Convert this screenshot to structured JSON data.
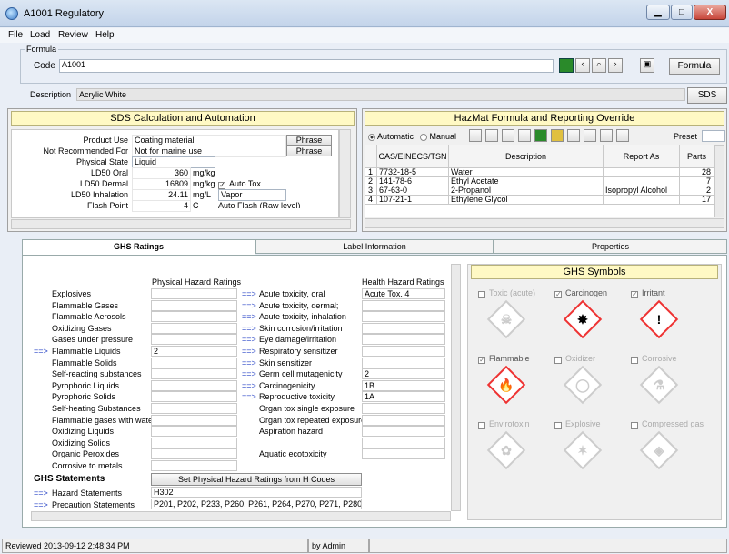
{
  "window": {
    "title": "A1001 Regulatory",
    "minimize": "▁",
    "maximize": "□",
    "close": "X"
  },
  "menu": [
    "File",
    "Load",
    "Review",
    "Help"
  ],
  "formula": {
    "group_label": "Formula",
    "code_label": "Code",
    "code": "A1001",
    "formula_button": "Formula",
    "description_label": "Description",
    "description": "Acrylic White",
    "sds_button": "SDS"
  },
  "sds": {
    "title": "SDS Calculation and Automation",
    "rows": [
      {
        "label": "Product Use",
        "value": "Coating material",
        "button": "Phrase"
      },
      {
        "label": "Not Recommended For",
        "value": "Not for marine use",
        "button": "Phrase"
      },
      {
        "label": "Physical State",
        "value": "Liquid"
      },
      {
        "label": "LD50 Oral",
        "value": "360",
        "unit": "mg/kg"
      },
      {
        "label": "LD50 Dermal",
        "value": "16809",
        "unit": "mg/kg",
        "extra": "Auto Tox"
      },
      {
        "label": "LD50 Inhalation",
        "value": "24.11",
        "unit": "mg/L",
        "extra": "Vapor"
      },
      {
        "label": "Flash Point",
        "value": "4",
        "unit": "C",
        "extra": "Auto Flash (Raw level)"
      }
    ]
  },
  "hazmat": {
    "title": "HazMat Formula and Reporting Override",
    "radio_auto": "Automatic",
    "radio_manual": "Manual",
    "preset_label": "Preset",
    "columns": [
      "CAS/EINECS/TSN",
      "Description",
      "Report As",
      "Parts"
    ],
    "rows": [
      {
        "n": "1",
        "cas": "7732-18-5",
        "desc": "Water",
        "report": "",
        "parts": "28"
      },
      {
        "n": "2",
        "cas": "141-78-6",
        "desc": "Ethyl Acetate",
        "report": "",
        "parts": "7"
      },
      {
        "n": "3",
        "cas": "67-63-0",
        "desc": "2-Propanol",
        "report": "Isopropyl Alcohol",
        "parts": "2"
      },
      {
        "n": "4",
        "cas": "107-21-1",
        "desc": "Ethylene Glycol",
        "report": "",
        "parts": "17"
      }
    ]
  },
  "tabs": [
    "GHS Ratings",
    "Label Information",
    "Properties"
  ],
  "ghs": {
    "phys_header": "Physical Hazard Ratings",
    "health_header": "Health Hazard Ratings",
    "phys": [
      {
        "label": "Explosives",
        "value": ""
      },
      {
        "label": "Flammable Gases",
        "value": ""
      },
      {
        "label": "Flammable Aerosols",
        "value": ""
      },
      {
        "label": "Oxidizing Gases",
        "value": ""
      },
      {
        "label": "Gases under pressure",
        "value": ""
      },
      {
        "label": "Flammable Liquids",
        "value": "2",
        "arrow": "==>"
      },
      {
        "label": "Flammable Solids",
        "value": ""
      },
      {
        "label": "Self-reacting substances",
        "value": ""
      },
      {
        "label": "Pyrophoric Liquids",
        "value": ""
      },
      {
        "label": "Pyrophoric Solids",
        "value": ""
      },
      {
        "label": "Self-heating Substances",
        "value": ""
      },
      {
        "label": "Flammable gases with water",
        "value": ""
      },
      {
        "label": "Oxidizing Liquids",
        "value": ""
      },
      {
        "label": "Oxidizing Solids",
        "value": ""
      },
      {
        "label": "Organic Peroxides",
        "value": ""
      },
      {
        "label": "Corrosive to metals",
        "value": ""
      }
    ],
    "health": [
      {
        "label": "Acute toxicity, oral",
        "value": "Acute Tox. 4",
        "arrow": "==>"
      },
      {
        "label": "Acute toxicity, dermal;",
        "value": "",
        "arrow": "==>"
      },
      {
        "label": "Acute toxicity, inhalation",
        "value": "",
        "arrow": "==>"
      },
      {
        "label": "Skin corrosion/irritation",
        "value": "",
        "arrow": "==>"
      },
      {
        "label": "Eye damage/irritation",
        "value": "",
        "arrow": "==>"
      },
      {
        "label": "Respiratory sensitizer",
        "value": "",
        "arrow": "==>"
      },
      {
        "label": "Skin sensitizer",
        "value": "",
        "arrow": "==>"
      },
      {
        "label": "Germ cell mutagenicity",
        "value": "2",
        "arrow": "==>"
      },
      {
        "label": "Carcinogenicity",
        "value": "1B",
        "arrow": "==>"
      },
      {
        "label": "Reproductive toxicity",
        "value": "1A",
        "arrow": "==>"
      },
      {
        "label": "Organ tox single exposure",
        "value": ""
      },
      {
        "label": "Organ tox repeated exposure",
        "value": ""
      },
      {
        "label": "Aspiration hazard",
        "value": ""
      },
      {
        "label": "",
        "value": ""
      },
      {
        "label": "Aquatic ecotoxicity",
        "value": ""
      }
    ],
    "statements_title": "GHS Statements",
    "set_button": "Set Physical Hazard Ratings from H Codes",
    "hazard_label": "Hazard Statements",
    "hazard_value": "H302",
    "precaution_label": "Precaution Statements",
    "precaution_value": "P201, P202, P233, P260, P261, P264, P270, P271, P280, P2"
  },
  "symbols": {
    "title": "GHS Symbols",
    "items": [
      {
        "label": "Toxic (acute)",
        "checked": false
      },
      {
        "label": "Carcinogen",
        "checked": true
      },
      {
        "label": "Irritant",
        "checked": true
      },
      {
        "label": "Flammable",
        "checked": true
      },
      {
        "label": "Oxidizer",
        "checked": false
      },
      {
        "label": "Corrosive",
        "checked": false
      },
      {
        "label": "Envirotoxin",
        "checked": false
      },
      {
        "label": "Explosive",
        "checked": false
      },
      {
        "label": "Compressed gas",
        "checked": false
      }
    ]
  },
  "status": {
    "reviewed": "Reviewed 2013-09-12 2:48:34 PM",
    "by": "by Admin"
  }
}
